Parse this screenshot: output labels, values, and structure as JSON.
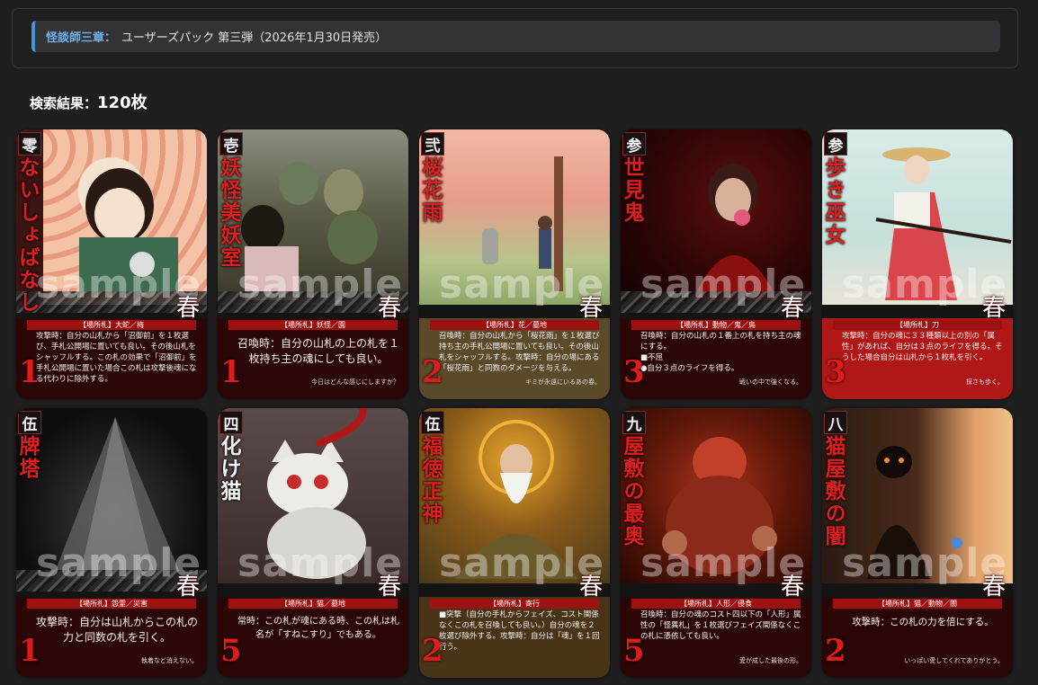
{
  "banner": {
    "chapter": "怪談師三章",
    "separator": "：",
    "title": "ユーザーズパック 第三弾（2026年1月30日発売）"
  },
  "results": {
    "label": "検索結果：",
    "count": "120枚"
  },
  "watermark": "sample",
  "cards": [
    {
      "num": "零",
      "name": "ないしょばなし",
      "type": "【場所札】大蛇／梅",
      "effect": "攻撃時：自分の山札から「沼御前」を１枚選び、手札公開場に置いても良い。その後山札をシャッフルする。この札の効果で「沼御前」を手札公開場に置いた場合この札は攻撃後魂になる代わりに除外する。",
      "flavor": "",
      "cost": "1",
      "season": "春"
    },
    {
      "num": "壱",
      "name": "妖怪美妖室",
      "type": "【場所札】妖怪／園",
      "effect": "召喚時：自分の山札の上の札を１枚持ち主の魂にしても良い。",
      "flavor": "今日はどんな感じにしますか？",
      "cost": "1",
      "season": "春"
    },
    {
      "num": "弐",
      "name": "桜花雨",
      "type": "【場所札】花／墓地",
      "effect": "召喚時：自分の山札から「桜花雨」を１枚選び持ち主の手札公開場に置いても良い。その後山札をシャッフルする。攻撃時：自分の場にある「桜花雨」と同数のダメージを与える。",
      "flavor": "キミが永遠にいるあの春。",
      "cost": "2",
      "season": "春"
    },
    {
      "num": "参",
      "name": "世見鬼",
      "type": "【場所札】動物／鬼／鳥",
      "effect": "召喚時：自分の山札の１番上の札を持ち主の魂にする。\n■不屈\n●自分３点のライフを得る。",
      "flavor": "戦いの中で強くなる。",
      "cost": "3",
      "season": "春"
    },
    {
      "num": "参",
      "name": "歩き巫女",
      "type": "【場所札】刀",
      "effect": "攻撃時：自分の魂に３３種類以上の別の「属性」があれば、自分は３点のライフを得る。そうした場合自分は山札から１枚札を引く。",
      "flavor": "探さも歩く。",
      "cost": "3",
      "season": "春"
    },
    {
      "num": "伍",
      "name": "牌塔",
      "type": "【場所札】怨霊／災害",
      "effect": "攻撃時：自分は山札からこの札の力と同数の札を引く。",
      "flavor": "執着など消えない。",
      "cost": "1",
      "season": "春"
    },
    {
      "num": "四",
      "name": "化け猫",
      "type": "【場所札】猫／墓地",
      "effect": "常時：この札が魂にある時、この札は札名が「すねこすり」でもある。",
      "flavor": "",
      "cost": "5",
      "season": "春"
    },
    {
      "num": "伍",
      "name": "福徳正神",
      "type": "【場所札】寄行",
      "effect": "■突撃（自分の手札からフェイズ、コスト関係なくこの札を召喚しても良い。）自分の魂を２枚選び除外する。攻撃時：自分は「魂」を１回行う。",
      "flavor": "",
      "cost": "2",
      "season": "春"
    },
    {
      "num": "九",
      "name": "屋敷の最奥",
      "type": "【場所札】人形／侵食",
      "effect": "召喚時：自分の魂のコスト四以下の「人形」属性の「怪異札」を１枚選びフェイズ関係なくこの札に憑依しても良い。",
      "flavor": "愛が成した最後の形。",
      "cost": "5",
      "season": "春"
    },
    {
      "num": "八",
      "name": "猫屋敷の闇",
      "type": "【場所札】猫／動物／闇",
      "effect": "攻撃時：この札の力を倍にする。",
      "flavor": "いっぱい愛してくれてありがとう。",
      "cost": "2",
      "season": "春"
    }
  ]
}
